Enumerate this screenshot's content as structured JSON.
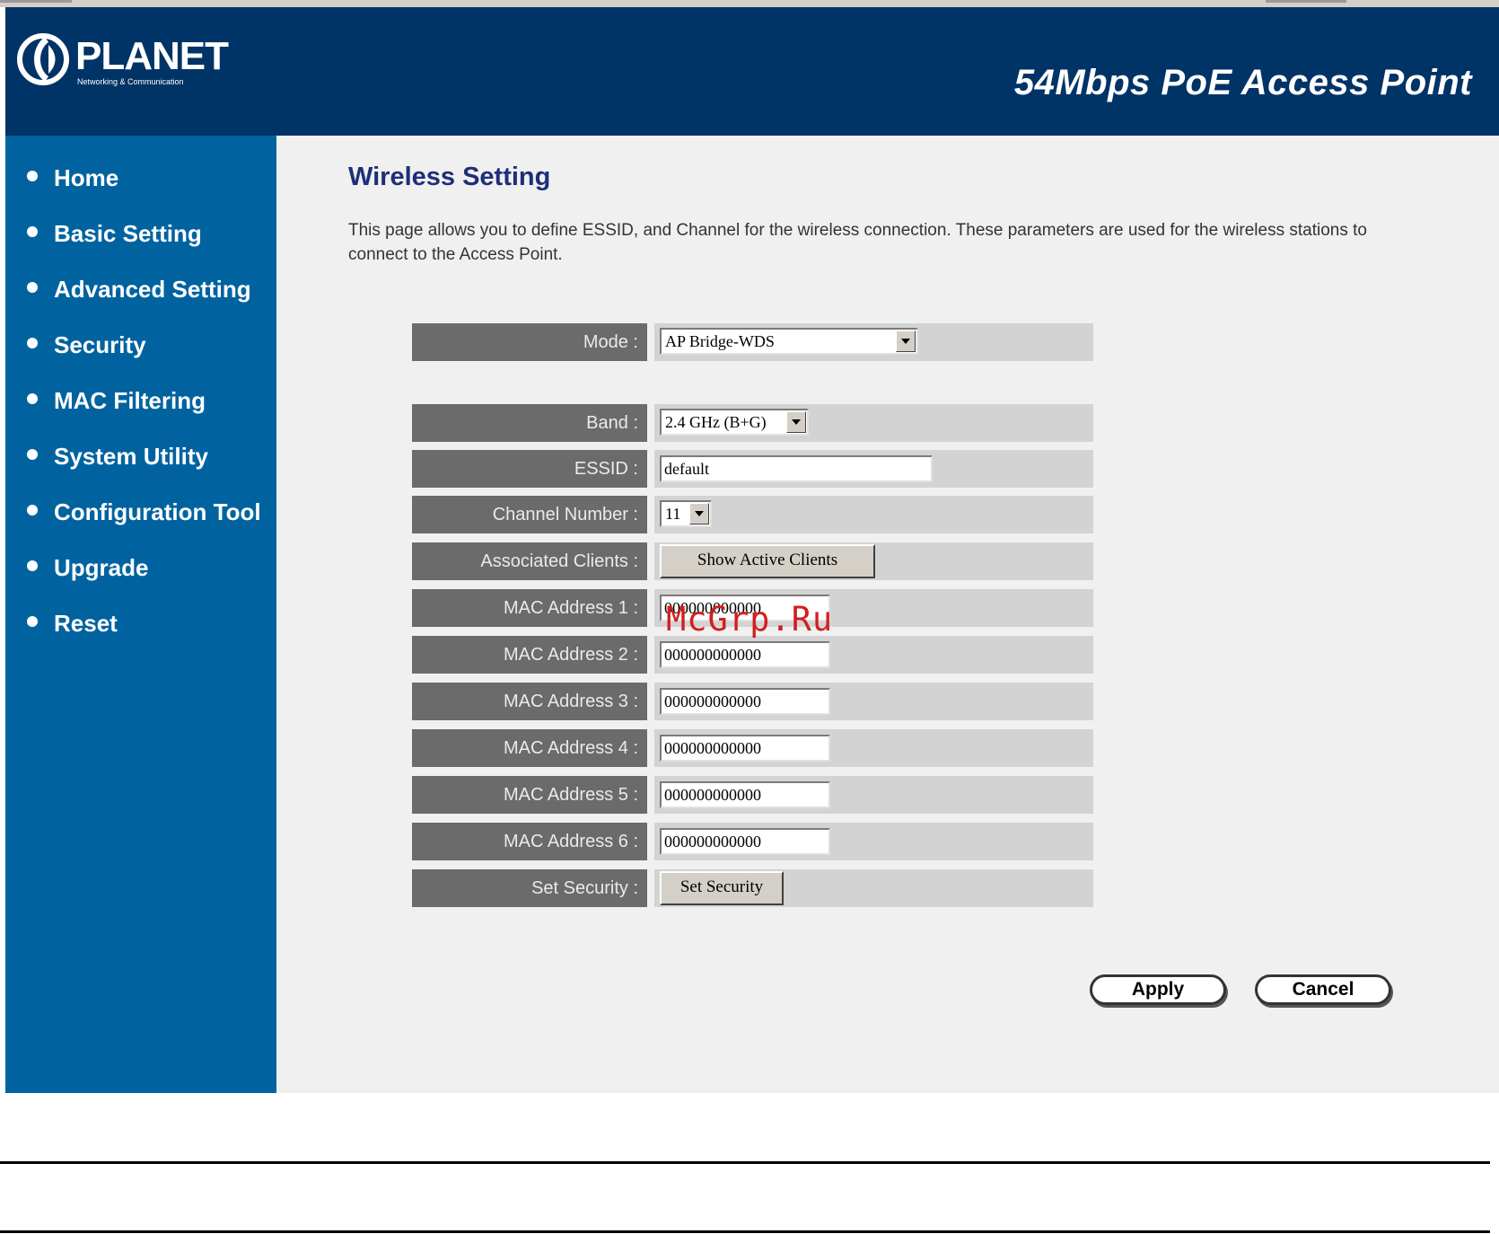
{
  "brand": {
    "name": "PLANET",
    "tagline": "Networking & Communication"
  },
  "product_title": "54Mbps PoE Access Point",
  "sidebar": {
    "items": [
      {
        "label": "Home"
      },
      {
        "label": "Basic Setting"
      },
      {
        "label": "Advanced Setting"
      },
      {
        "label": "Security"
      },
      {
        "label": "MAC Filtering"
      },
      {
        "label": "System Utility"
      },
      {
        "label": "Configuration Tool"
      },
      {
        "label": "Upgrade"
      },
      {
        "label": "Reset"
      }
    ]
  },
  "main": {
    "title": "Wireless Setting",
    "description": "This page allows you to define ESSID, and Channel for the wireless connection. These parameters are used for the wireless stations to connect to the Access Point.",
    "form": {
      "mode": {
        "label": "Mode :",
        "value": "AP Bridge-WDS"
      },
      "band": {
        "label": "Band :",
        "value": "2.4 GHz (B+G)"
      },
      "essid": {
        "label": "ESSID :",
        "value": "default"
      },
      "channel": {
        "label": "Channel Number :",
        "value": "11"
      },
      "associated_clients": {
        "label": "Associated Clients :",
        "button": "Show Active Clients"
      },
      "mac_addresses": [
        {
          "label": "MAC Address 1 :",
          "value": "000000000000"
        },
        {
          "label": "MAC Address 2 :",
          "value": "000000000000"
        },
        {
          "label": "MAC Address 3 :",
          "value": "000000000000"
        },
        {
          "label": "MAC Address 4 :",
          "value": "000000000000"
        },
        {
          "label": "MAC Address 5 :",
          "value": "000000000000"
        },
        {
          "label": "MAC Address 6 :",
          "value": "000000000000"
        }
      ],
      "set_security": {
        "label": "Set Security :",
        "button": "Set Security"
      }
    },
    "apply_label": "Apply",
    "cancel_label": "Cancel"
  },
  "watermark": "McGrp.Ru",
  "colors": {
    "header_bg": "#003366",
    "sidebar_bg": "#0063a0",
    "content_bg": "#f0f0f0",
    "title_color": "#1e2f78",
    "label_bg": "#6b6b6b",
    "value_bg": "#d3d3d3",
    "watermark": "#d21f1f"
  }
}
